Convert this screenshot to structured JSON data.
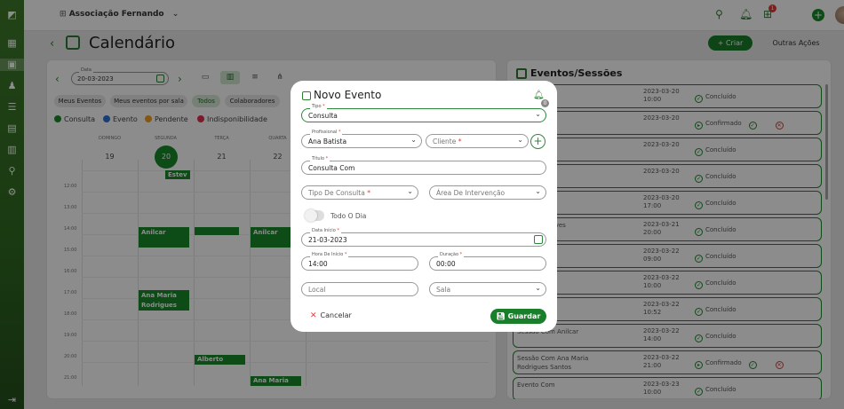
{
  "org": {
    "name": "Associação Fernando"
  },
  "header": {
    "badge_count": "1",
    "add_label": "+"
  },
  "page": {
    "title": "Calendário",
    "criar_label": "+ Criar",
    "outras_label": "Outras Ações"
  },
  "toolbar": {
    "date_label": "Data",
    "date_value": "20-03-2023"
  },
  "filters": [
    "Meus Eventos",
    "Meus eventos por sala",
    "Todos",
    "Colaboradores"
  ],
  "legend": [
    {
      "label": "Consulta",
      "color": "#1a8a2a"
    },
    {
      "label": "Evento",
      "color": "#2f6fd6"
    },
    {
      "label": "Pendente",
      "color": "#f0a020"
    },
    {
      "label": "Indisponibilidade",
      "color": "#e0304a"
    }
  ],
  "calendar": {
    "days": [
      {
        "name": "DOMINGO",
        "num": "19"
      },
      {
        "name": "SEGUNDA",
        "num": "20"
      },
      {
        "name": "TERÇA",
        "num": "21"
      },
      {
        "name": "QUARTA",
        "num": "22"
      }
    ],
    "hours": [
      "12:00",
      "13:00",
      "14:00",
      "15:00",
      "16:00",
      "17:00",
      "18:00",
      "19:00",
      "20:00",
      "21:00"
    ],
    "events": [
      {
        "t1": "Estev",
        "t2": ""
      },
      {
        "t1": "Anilcar",
        "t2": ""
      },
      {
        "t1": "",
        "t2": ""
      },
      {
        "t1": "Anilcar",
        "t2": ""
      },
      {
        "t1": "Ana Maria",
        "t2": "Rodrigues"
      },
      {
        "t1": "Alberto",
        "t2": ""
      },
      {
        "t1": "Ana Maria",
        "t2": ""
      }
    ]
  },
  "right": {
    "title": "Eventos/Sessões",
    "rows": [
      {
        "n1": "",
        "n2": "",
        "date": "2023-03-20",
        "time": "10:00",
        "status": "Concluído"
      },
      {
        "n1": "iano Nicolau",
        "n2": "",
        "date": "2023-03-20",
        "time": "",
        "status": "Confirmado"
      },
      {
        "n1": "ana Esteves",
        "n2": "",
        "date": "2023-03-20",
        "time": "",
        "status": "Concluído"
      },
      {
        "n1": "nilcar",
        "n2": "",
        "date": "2023-03-20",
        "time": "",
        "status": "Concluído"
      },
      {
        "n1": "na Maria",
        "n2": "ntos",
        "date": "2023-03-20",
        "time": "17:00",
        "status": "Concluído"
      },
      {
        "n1": "Alberto Esteves",
        "n2": "",
        "date": "2023-03-21",
        "time": "20:00",
        "status": "Concluído"
      },
      {
        "n1": "",
        "n2": "",
        "date": "2023-03-22",
        "time": "09:00",
        "status": "Concluído"
      },
      {
        "n1": "",
        "n2": "",
        "date": "2023-03-22",
        "time": "10:00",
        "status": "Concluído"
      },
      {
        "n1": "ana Esteves",
        "n2": "",
        "date": "2023-03-22",
        "time": "10:52",
        "status": "Concluído"
      },
      {
        "n1": "Sessão Com Anilcar",
        "n2": "",
        "date": "2023-03-22",
        "time": "14:00",
        "status": "Concluído"
      },
      {
        "n1": "Sessão Com Ana Maria",
        "n2": "Rodrigues Santos",
        "date": "2023-03-22",
        "time": "21:00",
        "status": "Confirmado"
      },
      {
        "n1": "Evento Com",
        "n2": "",
        "date": "2023-03-23",
        "time": "10:00",
        "status": "Concluído"
      }
    ]
  },
  "modal": {
    "title": "Novo Evento",
    "bell_badge": "0",
    "tipo": {
      "label": "Tipo",
      "value": "Consulta"
    },
    "profissional": {
      "label": "Profissional",
      "value": "Ana Batista"
    },
    "cliente": {
      "placeholder": "Cliente"
    },
    "titulo": {
      "label": "Título",
      "value": "Consulta Com"
    },
    "tipo_consulta": {
      "placeholder": "Tipo De Consulta"
    },
    "area": {
      "placeholder": "Área De Intervenção"
    },
    "todo_dia": "Todo O Dia",
    "data_inicio": {
      "label": "Data Início",
      "value": "21-03-2023"
    },
    "hora_inicio": {
      "label": "Hora De Início",
      "value": "14:00"
    },
    "duracao": {
      "label": "Duração",
      "value": "00:00"
    },
    "local": {
      "placeholder": "Local"
    },
    "sala": {
      "placeholder": "Sala"
    },
    "cancel_label": "Cancelar",
    "save_label": "Guardar"
  }
}
